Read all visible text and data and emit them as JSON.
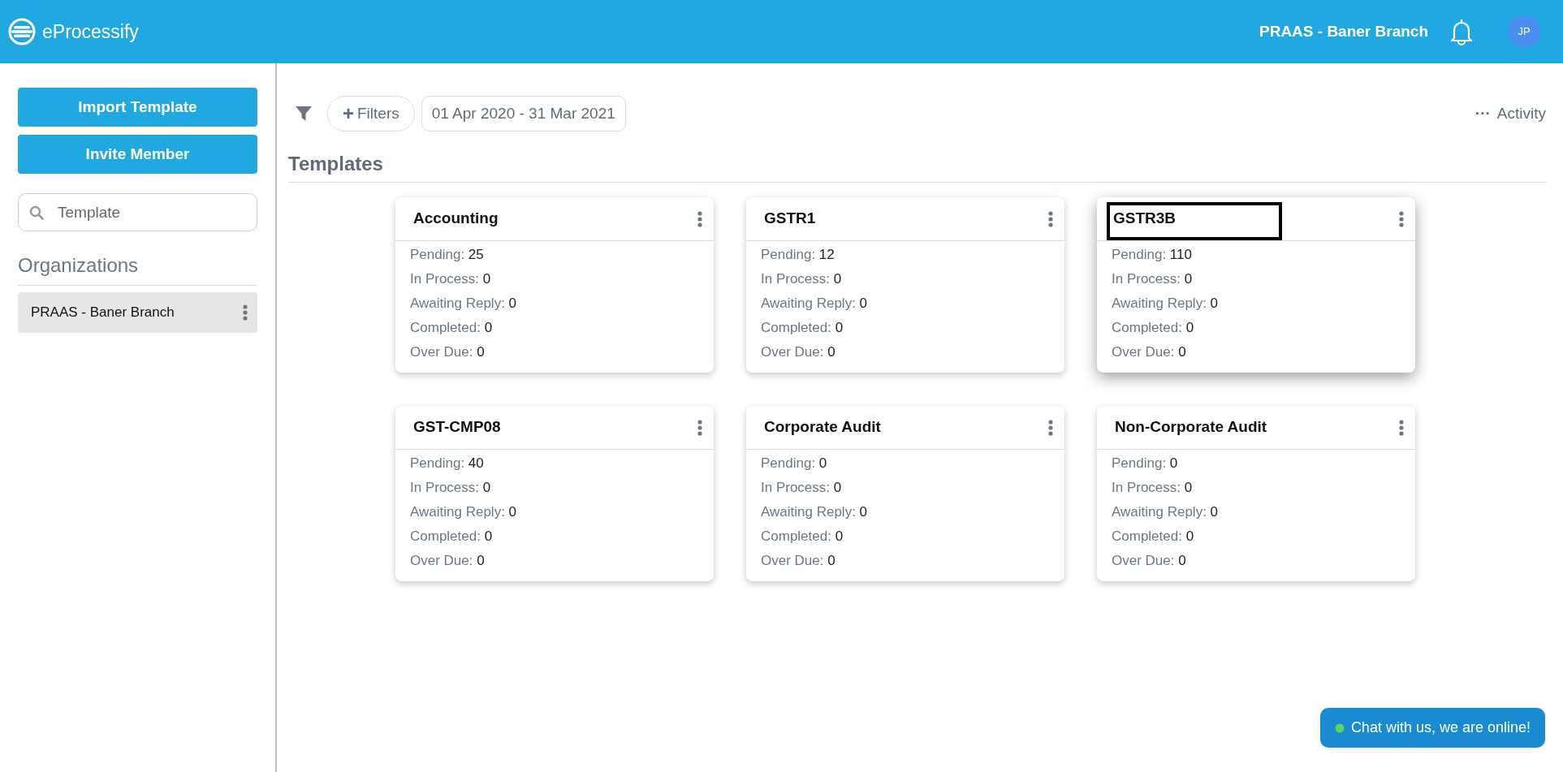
{
  "header": {
    "brand": "eProcessify",
    "organization": "PRAAS - Baner Branch",
    "avatar": "JP"
  },
  "sidebar": {
    "buttons": [
      "Import Template",
      "Invite Member"
    ],
    "search": {
      "value": "Template"
    },
    "section_title": "Organizations",
    "organizations": [
      {
        "name": "PRAAS - Baner Branch",
        "selected": true
      }
    ]
  },
  "toolbar": {
    "filters_button": "Filters",
    "plus": "+",
    "date_range": "01 Apr 2020 - 31 Mar 2021",
    "activity": "Activity",
    "ellipsis": "···"
  },
  "section_title": "Templates",
  "templates": [
    {
      "name": "Accounting",
      "highlighted": false,
      "stats": [
        {
          "label": "Pending:",
          "value": "25"
        },
        {
          "label": "In Process:",
          "value": "0"
        },
        {
          "label": "Awaiting Reply:",
          "value": "0"
        },
        {
          "label": "Completed:",
          "value": "0"
        },
        {
          "label": "Over Due:",
          "value": "0"
        }
      ]
    },
    {
      "name": "GSTR1",
      "highlighted": false,
      "stats": [
        {
          "label": "Pending:",
          "value": "12"
        },
        {
          "label": "In Process:",
          "value": "0"
        },
        {
          "label": "Awaiting Reply:",
          "value": "0"
        },
        {
          "label": "Completed:",
          "value": "0"
        },
        {
          "label": "Over Due:",
          "value": "0"
        }
      ]
    },
    {
      "name": "GSTR3B",
      "highlighted": true,
      "stats": [
        {
          "label": "Pending:",
          "value": "110"
        },
        {
          "label": "In Process:",
          "value": "0"
        },
        {
          "label": "Awaiting Reply:",
          "value": "0"
        },
        {
          "label": "Completed:",
          "value": "0"
        },
        {
          "label": "Over Due:",
          "value": "0"
        }
      ]
    },
    {
      "name": "GST-CMP08",
      "highlighted": false,
      "stats": [
        {
          "label": "Pending:",
          "value": "40"
        },
        {
          "label": "In Process:",
          "value": "0"
        },
        {
          "label": "Awaiting Reply:",
          "value": "0"
        },
        {
          "label": "Completed:",
          "value": "0"
        },
        {
          "label": "Over Due:",
          "value": "0"
        }
      ]
    },
    {
      "name": "Corporate Audit",
      "highlighted": false,
      "stats": [
        {
          "label": "Pending:",
          "value": "0"
        },
        {
          "label": "In Process:",
          "value": "0"
        },
        {
          "label": "Awaiting Reply:",
          "value": "0"
        },
        {
          "label": "Completed:",
          "value": "0"
        },
        {
          "label": "Over Due:",
          "value": "0"
        }
      ]
    },
    {
      "name": "Non-Corporate Audit",
      "highlighted": false,
      "stats": [
        {
          "label": "Pending:",
          "value": "0"
        },
        {
          "label": "In Process:",
          "value": "0"
        },
        {
          "label": "Awaiting Reply:",
          "value": "0"
        },
        {
          "label": "Completed:",
          "value": "0"
        },
        {
          "label": "Over Due:",
          "value": "0"
        }
      ]
    }
  ],
  "chat": {
    "label": "Chat with us, we are online!",
    "online": true
  }
}
